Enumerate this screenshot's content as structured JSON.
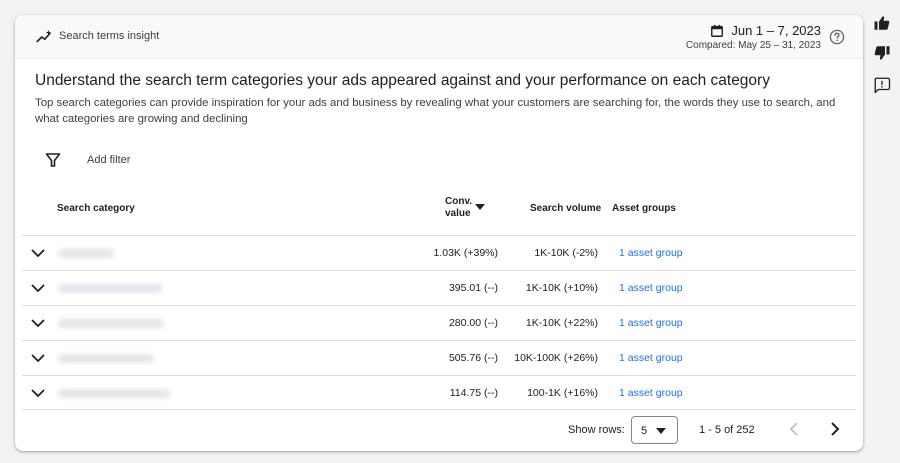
{
  "header": {
    "title": "Search terms insight",
    "icon": "trending-up-icon",
    "date_range": "Jun 1 – 7, 2023",
    "compared": "Compared: May 25 – 31, 2023"
  },
  "headline": "Understand the search term categories your ads appeared against and your performance on each category",
  "description": "Top search categories can provide inspiration for your ads and business by revealing what your customers are searching for, the words they use to search, and what categories are growing and declining",
  "filter": {
    "label": "Add filter"
  },
  "table": {
    "columns": {
      "category": "Search category",
      "conv_line1": "Conv.",
      "conv_line2": "value",
      "volume": "Search volume",
      "assets": "Asset groups"
    },
    "rows": [
      {
        "conv": "1.03K (+39%)",
        "volume": "1K-10K (-2%)",
        "assets": "1 asset group"
      },
      {
        "conv": "395.01 (--)",
        "volume": "1K-10K (+10%)",
        "assets": "1 asset group"
      },
      {
        "conv": "280.00 (--)",
        "volume": "1K-10K (+22%)",
        "assets": "1 asset group"
      },
      {
        "conv": "505.76 (--)",
        "volume": "10K-100K (+26%)",
        "assets": "1 asset group"
      },
      {
        "conv": "114.75 (--)",
        "volume": "100-1K (+16%)",
        "assets": "1 asset group"
      }
    ]
  },
  "pagination": {
    "show_rows_label": "Show rows:",
    "rows_per_page": "5",
    "range": "1 - 5 of 252"
  },
  "side_actions": [
    "thumbs-up-icon",
    "thumbs-down-icon",
    "feedback-icon"
  ],
  "colors": {
    "link": "#1a73e8",
    "header_bg": "#f8f9fa",
    "page_bg": "#f1f3f4"
  }
}
